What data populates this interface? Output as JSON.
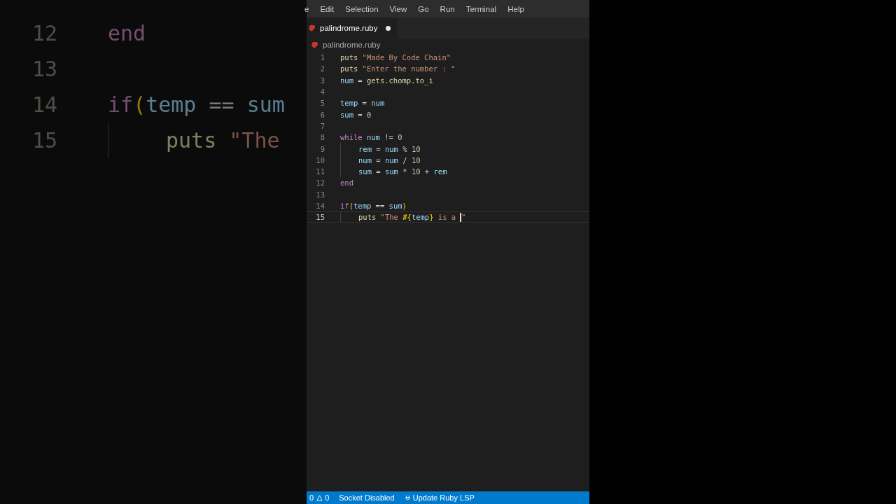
{
  "backdrop": {
    "lines": [
      {
        "number": "12",
        "indent": false,
        "tokens": [
          {
            "t": "end",
            "kind": "keyword"
          }
        ]
      },
      {
        "number": "13",
        "indent": false
      },
      {
        "number": "14",
        "indent": false,
        "tokens": [
          {
            "t": "if",
            "kind": "keyword"
          },
          {
            "t": "(",
            "kind": "bracket"
          },
          {
            "t": "temp",
            "kind": "var"
          },
          {
            "t": " == ",
            "kind": "op"
          },
          {
            "t": "sum",
            "kind": "var"
          }
        ]
      },
      {
        "number": "15",
        "indent": true,
        "tokens": [
          {
            "t": "puts ",
            "kind": "fn"
          },
          {
            "t": "\"The",
            "kind": "string"
          }
        ]
      }
    ]
  },
  "menu": [
    "e",
    "Edit",
    "Selection",
    "View",
    "Go",
    "Run",
    "Terminal",
    "Help"
  ],
  "tab": {
    "label": "palindrome.ruby",
    "modified": true
  },
  "breadcrumb": "palindrome.ruby",
  "lines": [
    {
      "number": "1",
      "current": false,
      "indent": false,
      "tokens": [
        {
          "t": "puts ",
          "kind": "fn"
        },
        {
          "t": "\"Made By Code Chain\"",
          "kind": "string"
        }
      ]
    },
    {
      "number": "2",
      "current": false,
      "indent": false,
      "tokens": [
        {
          "t": "puts ",
          "kind": "fn"
        },
        {
          "t": "\"Enter the number : \"",
          "kind": "string"
        }
      ]
    },
    {
      "number": "3",
      "current": false,
      "indent": false,
      "tokens": [
        {
          "t": "num",
          "kind": "var"
        },
        {
          "t": " = ",
          "kind": "op"
        },
        {
          "t": "gets.chomp.to_i",
          "kind": "fn"
        }
      ]
    },
    {
      "number": "4",
      "current": false,
      "indent": false
    },
    {
      "number": "5",
      "current": false,
      "indent": false,
      "tokens": [
        {
          "t": "temp",
          "kind": "var"
        },
        {
          "t": " = ",
          "kind": "op"
        },
        {
          "t": "num",
          "kind": "var"
        }
      ]
    },
    {
      "number": "6",
      "current": false,
      "indent": false,
      "tokens": [
        {
          "t": "sum",
          "kind": "var"
        },
        {
          "t": " = ",
          "kind": "op"
        },
        {
          "t": "0",
          "kind": "number"
        }
      ]
    },
    {
      "number": "7",
      "current": false,
      "indent": false
    },
    {
      "number": "8",
      "current": false,
      "indent": false,
      "tokens": [
        {
          "t": "while ",
          "kind": "keyword"
        },
        {
          "t": "num",
          "kind": "var"
        },
        {
          "t": " != ",
          "kind": "op"
        },
        {
          "t": "0",
          "kind": "number"
        }
      ]
    },
    {
      "number": "9",
      "current": false,
      "indent": true,
      "tokens": [
        {
          "t": "rem",
          "kind": "var"
        },
        {
          "t": " = ",
          "kind": "op"
        },
        {
          "t": "num",
          "kind": "var"
        },
        {
          "t": " % ",
          "kind": "op"
        },
        {
          "t": "10",
          "kind": "number"
        }
      ]
    },
    {
      "number": "10",
      "current": false,
      "indent": true,
      "tokens": [
        {
          "t": "num",
          "kind": "var"
        },
        {
          "t": " = ",
          "kind": "op"
        },
        {
          "t": "num",
          "kind": "var"
        },
        {
          "t": " / ",
          "kind": "op"
        },
        {
          "t": "10",
          "kind": "number"
        }
      ]
    },
    {
      "number": "11",
      "current": false,
      "indent": true,
      "tokens": [
        {
          "t": "sum",
          "kind": "var"
        },
        {
          "t": " = ",
          "kind": "op"
        },
        {
          "t": "sum",
          "kind": "var"
        },
        {
          "t": " * ",
          "kind": "op"
        },
        {
          "t": "10",
          "kind": "number"
        },
        {
          "t": " + ",
          "kind": "op"
        },
        {
          "t": "rem",
          "kind": "var"
        }
      ]
    },
    {
      "number": "12",
      "current": false,
      "indent": false,
      "tokens": [
        {
          "t": "end",
          "kind": "keyword"
        }
      ]
    },
    {
      "number": "13",
      "current": false,
      "indent": false
    },
    {
      "number": "14",
      "current": false,
      "indent": false,
      "tokens": [
        {
          "t": "if",
          "kind": "keyword"
        },
        {
          "t": "(",
          "kind": "bracket"
        },
        {
          "t": "temp",
          "kind": "var"
        },
        {
          "t": " == ",
          "kind": "op"
        },
        {
          "t": "sum",
          "kind": "var"
        },
        {
          "t": ")",
          "kind": "bracket"
        }
      ]
    },
    {
      "number": "15",
      "current": true,
      "indent": true,
      "tokens": [
        {
          "t": "puts ",
          "kind": "fn"
        },
        {
          "t": "\"The ",
          "kind": "string"
        },
        {
          "t": "#{",
          "kind": "bracket"
        },
        {
          "t": "temp",
          "kind": "var"
        },
        {
          "t": "}",
          "kind": "bracket"
        },
        {
          "t": " is a ",
          "kind": "string"
        },
        {
          "t": "\"",
          "kind": "string",
          "caret": true
        }
      ]
    }
  ],
  "status_bar": {
    "errors": "0",
    "warnings": "0",
    "socket": "Socket Disabled",
    "lsp": "Update Ruby LSP"
  }
}
